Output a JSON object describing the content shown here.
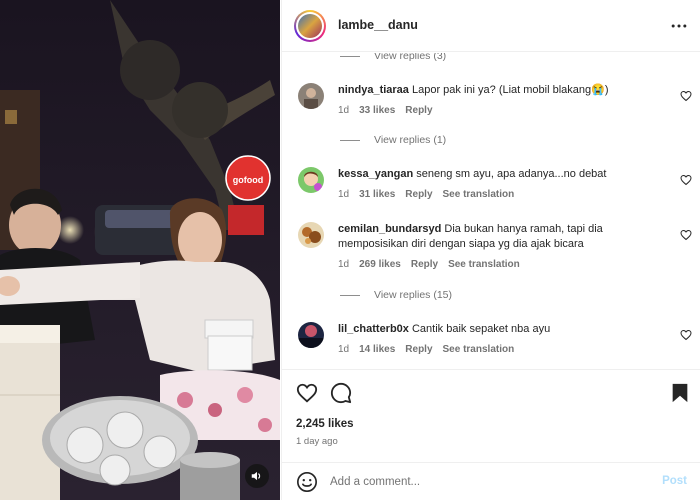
{
  "post": {
    "username": "lambe__danu",
    "likes_text": "2,245 likes",
    "time_ago": "1 day ago"
  },
  "comments_top_replies": "View replies (3)",
  "comments": [
    {
      "username": "nindya_tiaraa",
      "text": "Lapor pak ini ya? (Liat mobil blakang😭)",
      "time": "1d",
      "likes": "33 likes",
      "reply": "Reply",
      "see_translation": "",
      "view_replies": "View replies (1)"
    },
    {
      "username": "kessa_yangan",
      "text": "seneng sm ayu, apa adanya...no debat",
      "time": "1d",
      "likes": "31 likes",
      "reply": "Reply",
      "see_translation": "See translation",
      "view_replies": ""
    },
    {
      "username": "cemilan_bundarsyd",
      "text": "Dia bukan hanya ramah, tapi dia memposisikan diri dengan siapa yg dia ajak bicara",
      "time": "1d",
      "likes": "269 likes",
      "reply": "Reply",
      "see_translation": "See translation",
      "view_replies": "View replies (15)"
    },
    {
      "username": "lil_chatterb0x",
      "text": "Cantik baik sepaket nba ayu",
      "time": "1d",
      "likes": "14 likes",
      "reply": "Reply",
      "see_translation": "See translation",
      "view_replies": ""
    }
  ],
  "add_comment": {
    "placeholder": "Add a comment...",
    "post_label": "Post"
  },
  "media": {
    "sign_text": "gofood"
  },
  "colors": {
    "link_blue_disabled": "#b2dffc",
    "secondary_text": "#737373"
  }
}
